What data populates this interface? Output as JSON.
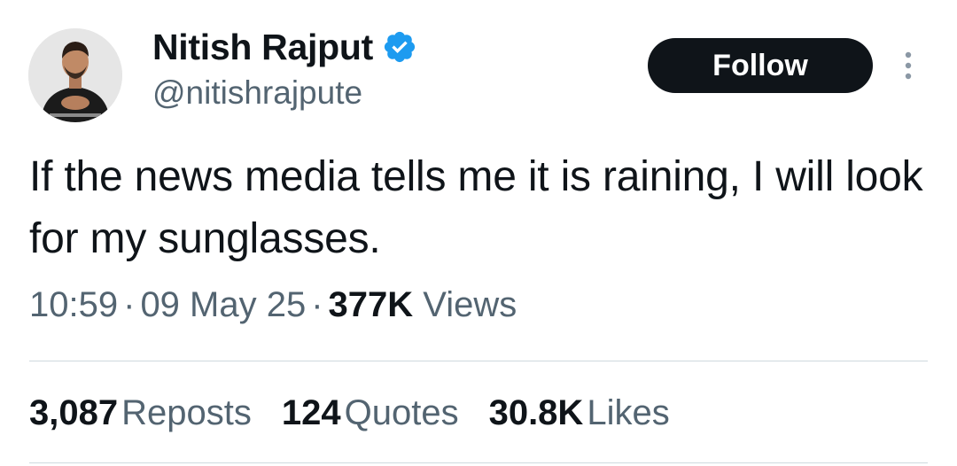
{
  "author": {
    "display_name": "Nitish Rajput",
    "handle": "@nitishrajpute",
    "verified": true
  },
  "actions": {
    "follow_label": "Follow"
  },
  "tweet": {
    "text": "If the news media tells me it is raining, I will look for my sunglasses.",
    "time": "10:59",
    "separator": "·",
    "date": "09 May 25",
    "views_count": "377K",
    "views_label": "Views"
  },
  "stats": {
    "reposts_count": "3,087",
    "reposts_label": "Reposts",
    "quotes_count": "124",
    "quotes_label": "Quotes",
    "likes_count": "30.8K",
    "likes_label": "Likes"
  },
  "colors": {
    "text_primary": "#0f1419",
    "text_secondary": "#536471",
    "verified_blue": "#1d9bf0",
    "button_bg": "#0f1419",
    "divider": "#cfd9de"
  },
  "icons": [
    "avatar-photo",
    "verified-badge-icon",
    "more-options-icon"
  ]
}
